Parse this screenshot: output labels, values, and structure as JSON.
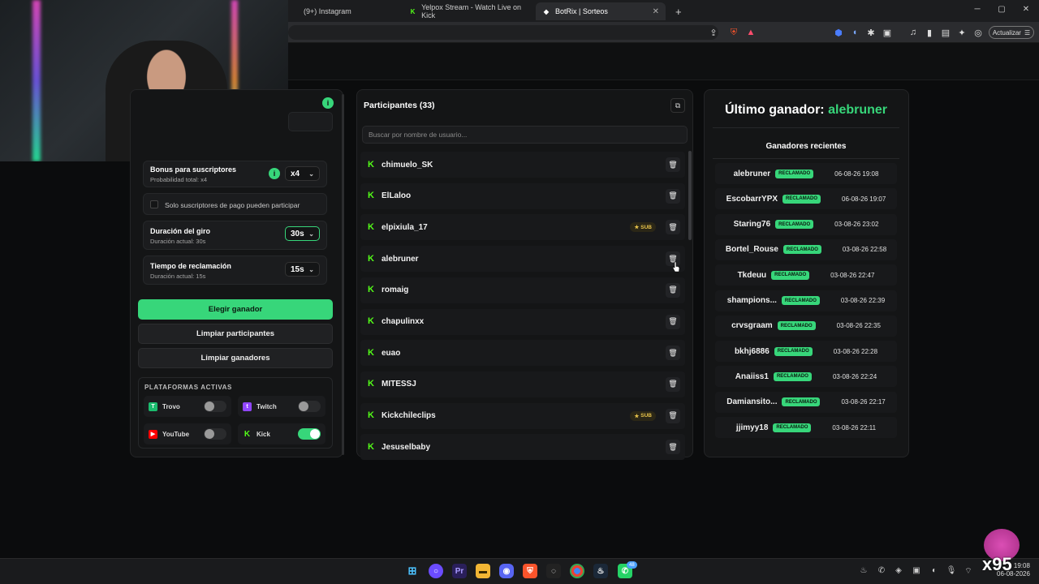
{
  "browser": {
    "tabs": [
      {
        "label": "(9+) Instagram",
        "icon": "instagram-icon"
      },
      {
        "label": "Yelpox Stream - Watch Live on Kick",
        "icon": "kick-icon"
      },
      {
        "label": "BotRix | Sorteos",
        "icon": "botrix-icon",
        "active": true
      }
    ],
    "new_tab": "+",
    "update_label": "Actualizar"
  },
  "left": {
    "sub_bonus": {
      "title": "Bonus para suscriptores",
      "subtitle": "Probabilidad total: x4",
      "value": "x4"
    },
    "paid_only_label": "Solo suscriptores de pago pueden participar",
    "spin": {
      "title": "Duración del giro",
      "subtitle": "Duración actual: 30s",
      "value": "30s"
    },
    "claim": {
      "title": "Tiempo de reclamación",
      "subtitle": "Duración actual: 15s",
      "value": "15s"
    },
    "pick_winner": "Elegir ganador",
    "clear_participants": "Limpiar participantes",
    "clear_winners": "Limpiar ganadores",
    "platforms_heading": "PLATAFORMAS ACTIVAS",
    "platforms": [
      {
        "name": "Trovo",
        "enabled": false,
        "color": "#1bbc6e"
      },
      {
        "name": "Twitch",
        "enabled": false,
        "color": "#9146ff"
      },
      {
        "name": "YouTube",
        "enabled": false,
        "color": "#ff0000"
      },
      {
        "name": "Kick",
        "enabled": true,
        "color": "#53fc18"
      }
    ]
  },
  "middle": {
    "title": "Participantes (33)",
    "search_placeholder": "Buscar por nombre de usuario...",
    "sub_badge": "SUB",
    "participants": [
      {
        "name": "chimuelo_SK",
        "sub": false
      },
      {
        "name": "ElLaloo",
        "sub": false
      },
      {
        "name": "elpixiula_17",
        "sub": true
      },
      {
        "name": "alebruner",
        "sub": false
      },
      {
        "name": "romaig",
        "sub": false
      },
      {
        "name": "chapulinxx",
        "sub": false
      },
      {
        "name": "euao",
        "sub": false
      },
      {
        "name": "MITESSJ",
        "sub": false
      },
      {
        "name": "Kickchileclips",
        "sub": true
      },
      {
        "name": "Jesuselbaby",
        "sub": false
      }
    ]
  },
  "right": {
    "last_winner_label": "Último ganador:",
    "last_winner_name": "alebruner",
    "recent_title": "Ganadores recientes",
    "claimed_label": "RECLAMADO",
    "winners": [
      {
        "name": "alebruner",
        "date": "06-08-26 19:08"
      },
      {
        "name": "EscobarrYPX",
        "date": "06-08-26 19:07"
      },
      {
        "name": "Staring76",
        "date": "03-08-26 23:02"
      },
      {
        "name": "Bortel_Rouse",
        "date": "03-08-26 22:58"
      },
      {
        "name": "Tkdeuu",
        "date": "03-08-26 22:47"
      },
      {
        "name": "shampions...",
        "date": "03-08-26 22:39"
      },
      {
        "name": "crvsgraam",
        "date": "03-08-26 22:35"
      },
      {
        "name": "bkhj6886",
        "date": "03-08-26 22:28"
      },
      {
        "name": "Anaiiss1",
        "date": "03-08-26 22:24"
      },
      {
        "name": "Damiansito...",
        "date": "03-08-26 22:17"
      },
      {
        "name": "jjimyy18",
        "date": "03-08-26 22:11"
      }
    ]
  },
  "taskbar": {
    "time": "19:08",
    "date": "06-08-2026",
    "whatsapp_badge": "48"
  },
  "overlay_text": "x95",
  "colors": {
    "accent": "#37d67a",
    "kick": "#53fc18"
  }
}
